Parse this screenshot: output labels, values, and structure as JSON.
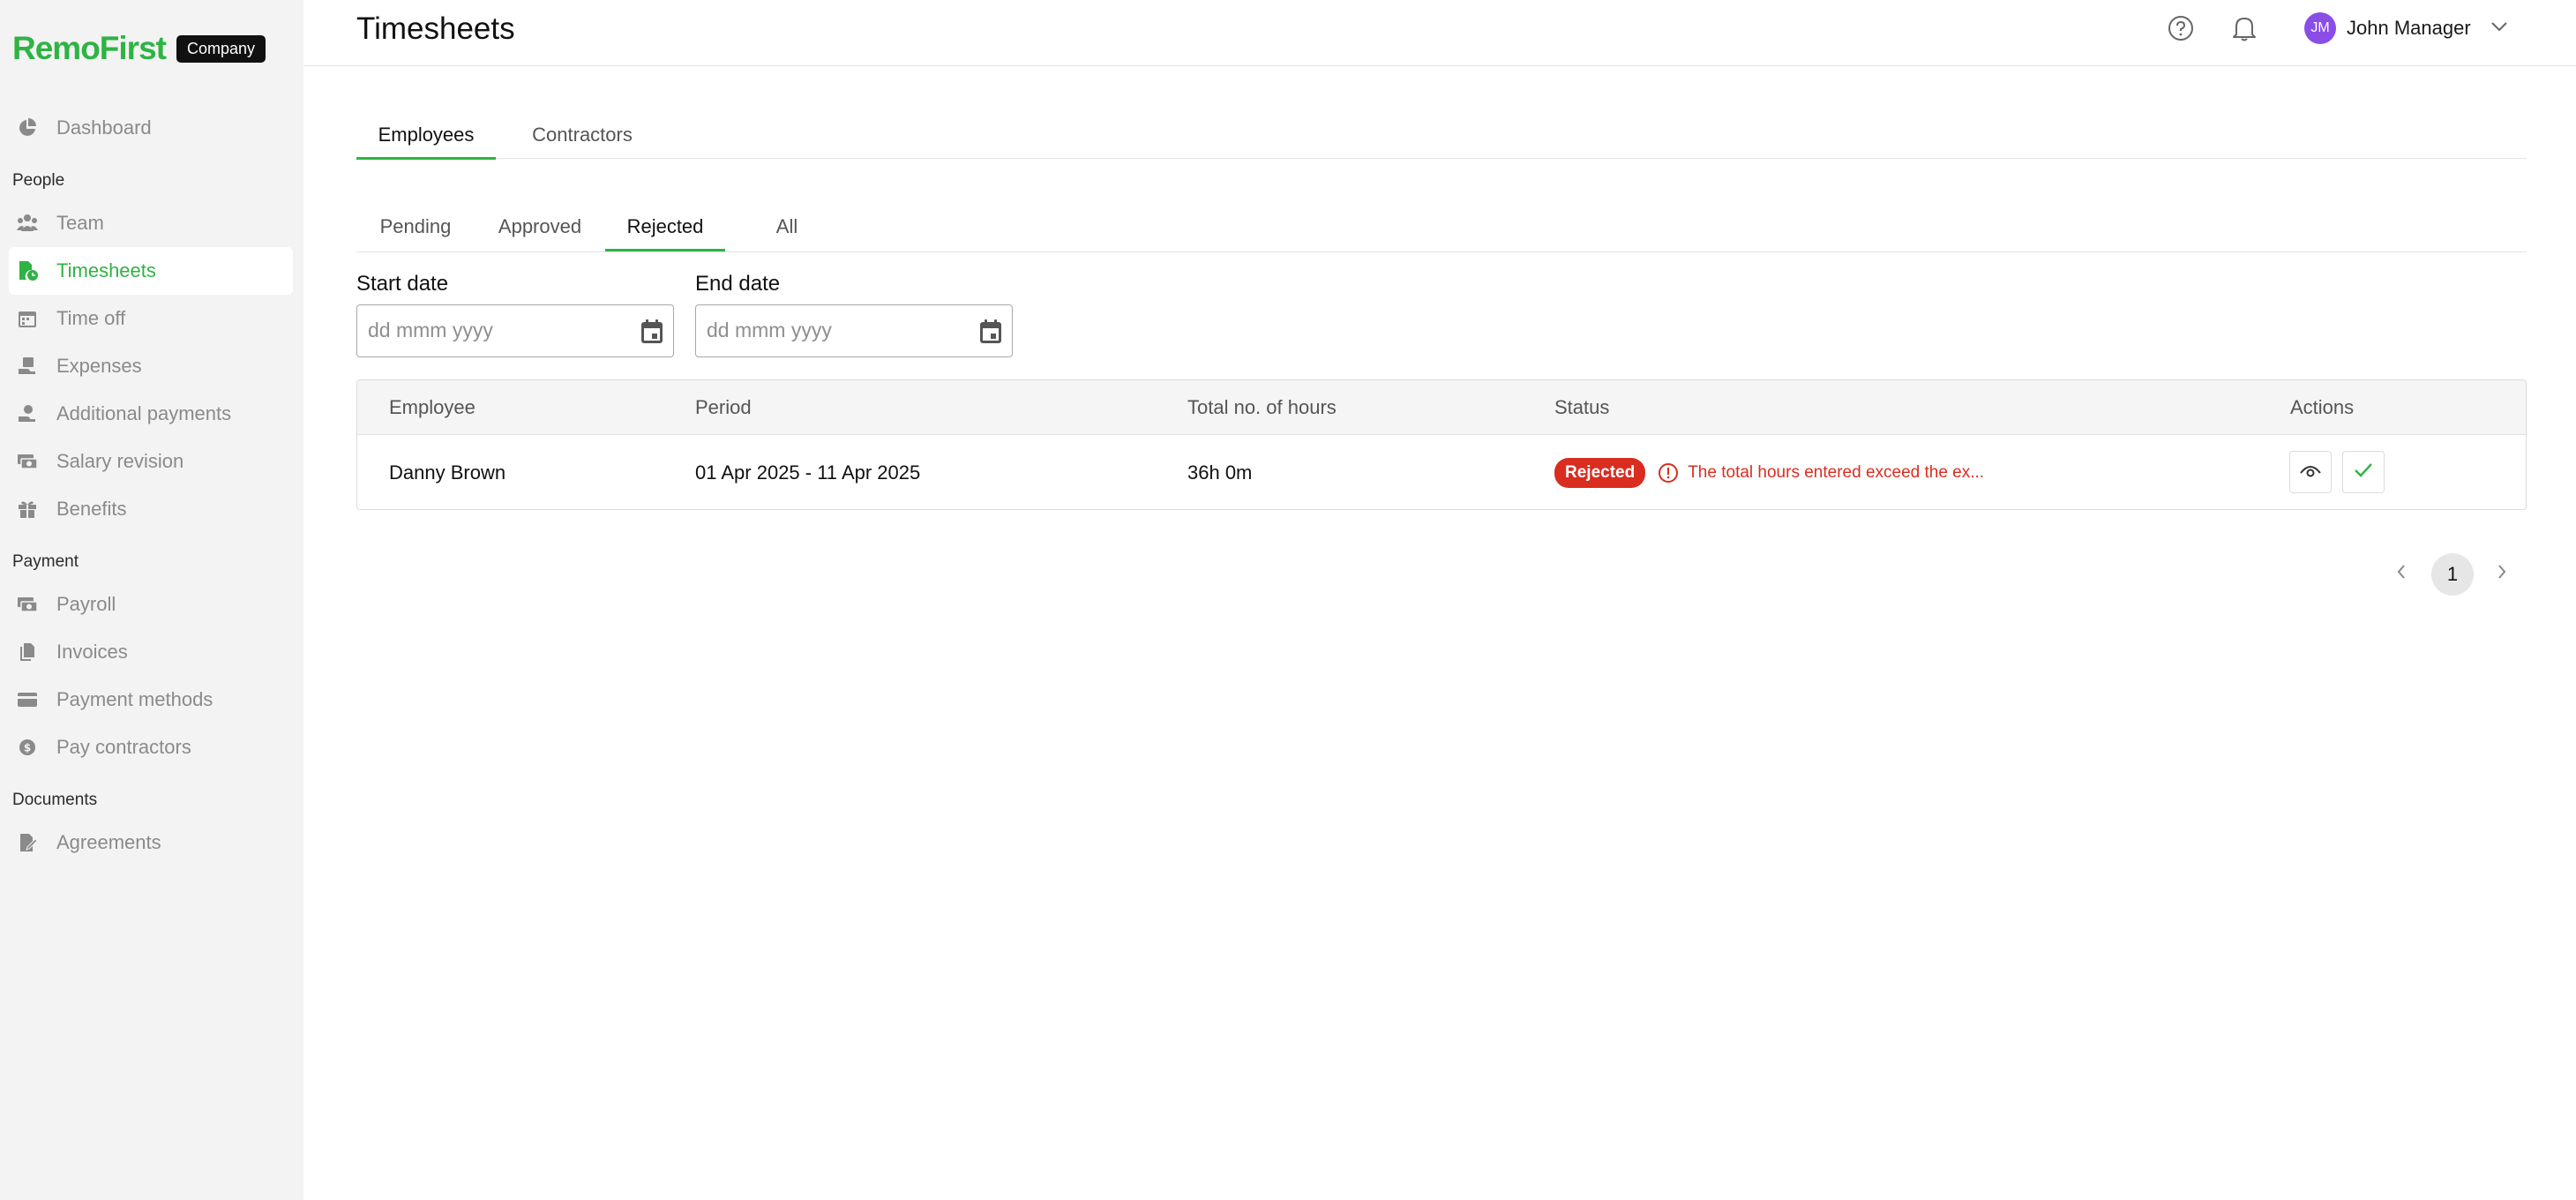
{
  "brand": {
    "name": "RemoFirst",
    "badge": "Company"
  },
  "sidebar": {
    "sections": {
      "people": "People",
      "payment": "Payment",
      "documents": "Documents"
    },
    "items": [
      {
        "label": "Dashboard"
      },
      {
        "label": "Team"
      },
      {
        "label": "Timesheets",
        "active": true
      },
      {
        "label": "Time off"
      },
      {
        "label": "Expenses"
      },
      {
        "label": "Additional payments"
      },
      {
        "label": "Salary revision"
      },
      {
        "label": "Benefits"
      },
      {
        "label": "Payroll"
      },
      {
        "label": "Invoices"
      },
      {
        "label": "Payment methods"
      },
      {
        "label": "Pay contractors"
      },
      {
        "label": "Agreements"
      }
    ]
  },
  "header": {
    "title": "Timesheets",
    "user": {
      "initials": "JM",
      "name": "John Manager"
    }
  },
  "tabs": {
    "main": [
      {
        "label": "Employees",
        "active": true
      },
      {
        "label": "Contractors"
      }
    ],
    "status": [
      {
        "label": "Pending"
      },
      {
        "label": "Approved"
      },
      {
        "label": "Rejected",
        "active": true
      },
      {
        "label": "All"
      }
    ]
  },
  "filters": {
    "start_label": "Start date",
    "end_label": "End date",
    "placeholder": "dd mmm yyyy"
  },
  "table": {
    "columns": [
      "Employee",
      "Period",
      "Total no. of hours",
      "Status",
      "Actions"
    ],
    "rows": [
      {
        "employee": "Danny Brown",
        "period": "01 Apr 2025 - 11 Apr 2025",
        "hours": "36h 0m",
        "status": "Rejected",
        "reason": "The total hours entered exceed the ex..."
      }
    ]
  },
  "pagination": {
    "current": "1"
  },
  "colors": {
    "brand": "#2fb344",
    "danger": "#d92d20",
    "avatar": "#8a4de8"
  }
}
